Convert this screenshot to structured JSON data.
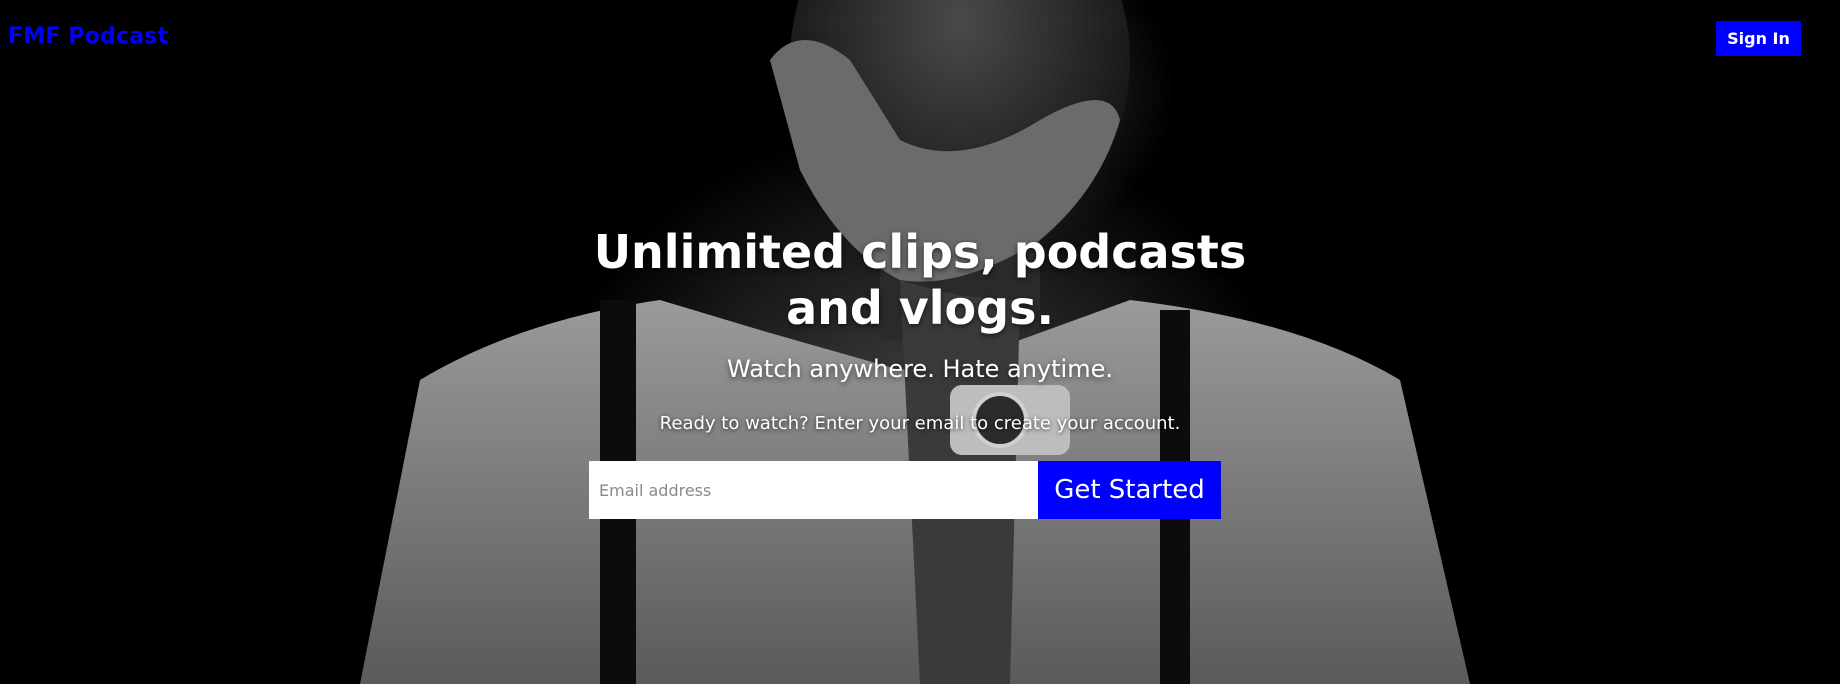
{
  "header": {
    "brand": "FMF Podcast",
    "sign_in_label": "Sign In"
  },
  "hero": {
    "headline_line1": "Unlimited clips, podcasts",
    "headline_line2": "and vlogs.",
    "subheadline": "Watch anywhere. Hate anytime.",
    "prompt": "Ready to watch? Enter your email to create your account.",
    "background_image": "black-and-white photo of a man covering his mouth with his hand"
  },
  "signup": {
    "email_placeholder": "Email address",
    "email_value": "",
    "cta_label": "Get Started"
  },
  "colors": {
    "accent": "#0000ff",
    "background": "#000000",
    "text": "#ffffff"
  }
}
